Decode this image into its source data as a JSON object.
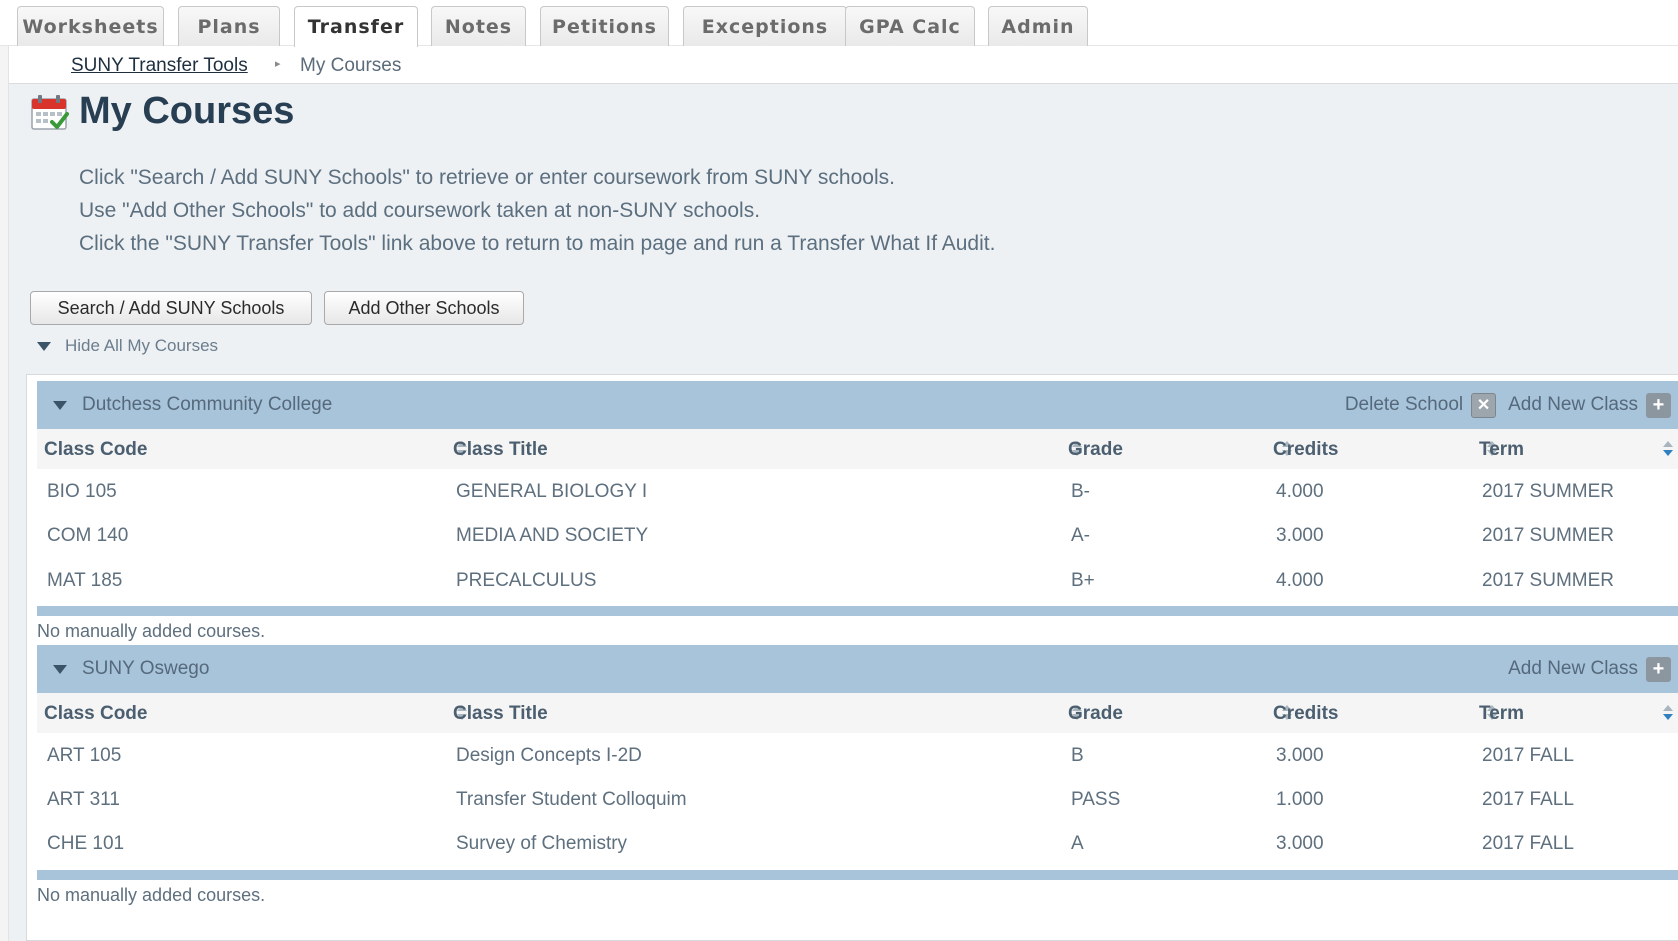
{
  "tabs": [
    {
      "label": "Worksheets",
      "active": false
    },
    {
      "label": "Plans",
      "active": false
    },
    {
      "label": "Transfer",
      "active": true
    },
    {
      "label": "Notes",
      "active": false
    },
    {
      "label": "Petitions",
      "active": false
    },
    {
      "label": "Exceptions",
      "active": false
    },
    {
      "label": "GPA Calc",
      "active": false
    },
    {
      "label": "Admin",
      "active": false
    }
  ],
  "breadcrumb": {
    "link": "SUNY Transfer Tools",
    "separator": "▸",
    "current": "My Courses"
  },
  "page": {
    "title": "My Courses",
    "icon": "calendar-check-icon",
    "instructions": [
      "Click \"Search / Add SUNY Schools\" to retrieve or enter coursework from SUNY schools.",
      "Use \"Add Other Schools\" to add coursework taken at non-SUNY schools.",
      "Click the \"SUNY Transfer Tools\" link above to return to main page and run a Transfer What If Audit."
    ]
  },
  "buttons": {
    "search_add": "Search / Add SUNY Schools",
    "add_other": "Add Other Schools"
  },
  "toggle_all": "Hide All My Courses",
  "columns": {
    "code": "Class Code",
    "title": "Class Title",
    "grade": "Grade",
    "credits": "Credits",
    "term": "Term"
  },
  "schools": [
    {
      "name": "Dutchess Community College",
      "delete_label": "Delete School",
      "add_label": "Add New Class",
      "courses": [
        {
          "code": "BIO 105",
          "title": "GENERAL BIOLOGY I",
          "grade": "B-",
          "credits": "4.000",
          "term": "2017 SUMMER"
        },
        {
          "code": "COM 140",
          "title": "MEDIA AND SOCIETY",
          "grade": "A-",
          "credits": "3.000",
          "term": "2017 SUMMER"
        },
        {
          "code": "MAT 185",
          "title": "PRECALCULUS",
          "grade": "B+",
          "credits": "4.000",
          "term": "2017 SUMMER"
        }
      ],
      "manual_note": "No manually added courses."
    },
    {
      "name": "SUNY Oswego",
      "add_label": "Add New Class",
      "courses": [
        {
          "code": "ART 105",
          "title": "Design Concepts I-2D",
          "grade": "B",
          "credits": "3.000",
          "term": "2017 FALL"
        },
        {
          "code": "ART 311",
          "title": "Transfer Student Colloquim",
          "grade": "PASS",
          "credits": "1.000",
          "term": "2017 FALL"
        },
        {
          "code": "CHE 101",
          "title": "Survey of Chemistry",
          "grade": "A",
          "credits": "3.000",
          "term": "2017 FALL"
        }
      ],
      "manual_note": "No manually added courses."
    }
  ],
  "colors": {
    "header_blue": "#a8c4db",
    "title_navy": "#283e52",
    "sort_active": "#2f7fc1"
  }
}
